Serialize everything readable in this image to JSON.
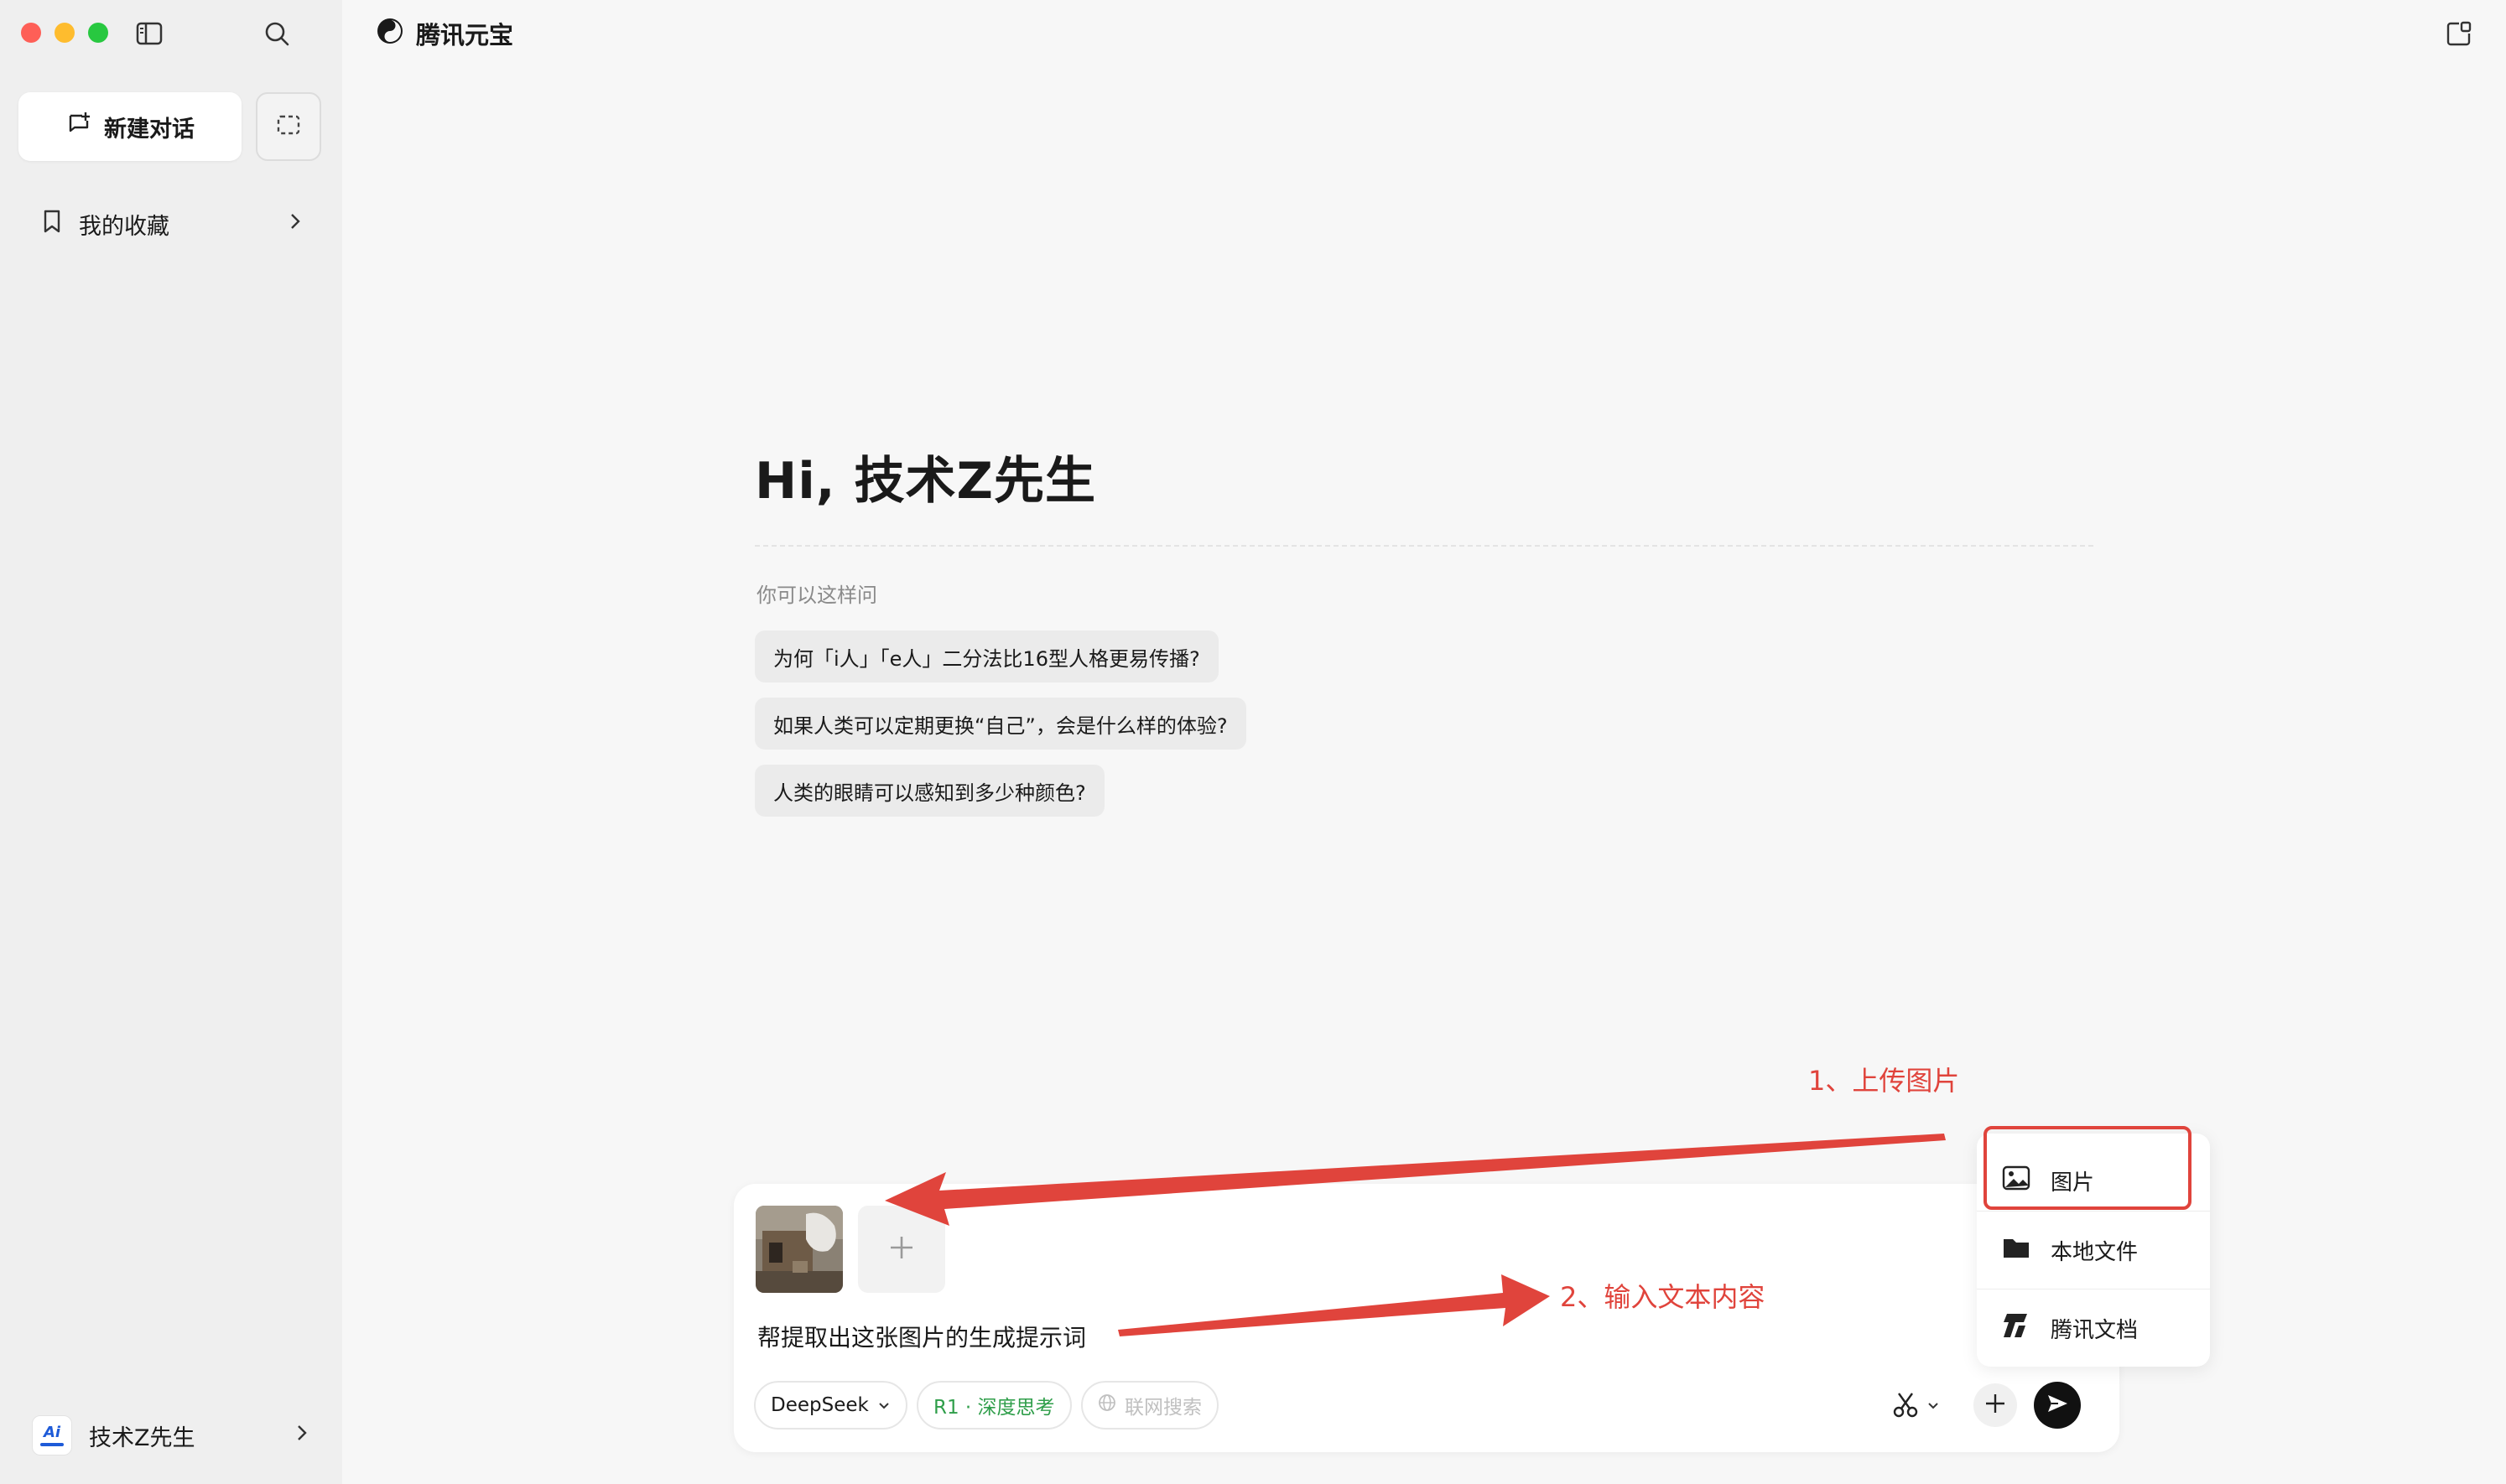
{
  "app": {
    "title": "腾讯元宝"
  },
  "sidebar": {
    "new_chat_label": "新建对话",
    "favorites_label": "我的收藏",
    "user": {
      "name": "技术Z先生",
      "avatar_text": "Ai"
    }
  },
  "main": {
    "greeting": "Hi, 技术Z先生",
    "hint_label": "你可以这样问",
    "suggestions": [
      "为何「i人」「e人」二分法比16型人格更易传播?",
      "如果人类可以定期更换“自己”，会是什么样的体验?",
      "人类的眼睛可以感知到多少种颜色?"
    ]
  },
  "composer": {
    "text": "帮提取出这张图片的生成提示词",
    "model_chip": "DeepSeek",
    "r1_chip": "R1 · 深度思考",
    "web_chip": "联网搜索"
  },
  "upload_menu": {
    "items": [
      "图片",
      "本地文件",
      "腾讯文档"
    ]
  },
  "annotations": {
    "step1": "1、上传图片",
    "step2": "2、输入文本内容"
  },
  "colors": {
    "annotation_red": "#e0443c",
    "r1_green": "#2f9e4a",
    "send_button": "#111111"
  }
}
